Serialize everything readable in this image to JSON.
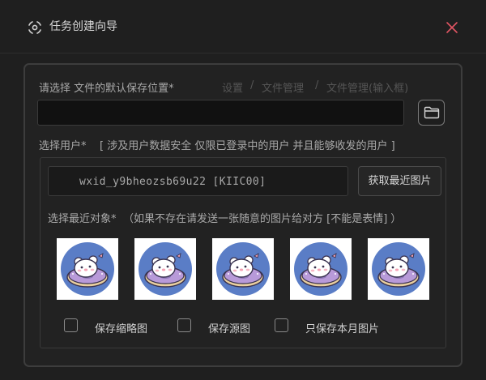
{
  "window": {
    "title": "任务创建向导",
    "icon": "wizard-icon",
    "close_icon": "close-icon",
    "close_color": "#e05563"
  },
  "save_location": {
    "label": "请选择 文件的默认保存位置*",
    "breadcrumb": [
      "设置",
      "文件管理",
      "文件管理(输入框)"
    ],
    "path_value": "",
    "browse_icon": "folder-icon"
  },
  "user_select": {
    "label": "选择用户*",
    "note": "[ 涉及用户数据安全  仅限已登录中的用户 并且能够收发的用户 ]",
    "wxid": "wxid_y9bheozsb69u22 [KIIC00]",
    "fetch_button": "获取最近图片",
    "recent_label": "选择最近对象*",
    "recent_hint": "（如果不存在请发送一张随意的图片给对方 [不能是表情] ）",
    "images": [
      {
        "name": "bear-donut-1"
      },
      {
        "name": "bear-donut-2"
      },
      {
        "name": "bear-donut-3"
      },
      {
        "name": "bear-donut-4"
      },
      {
        "name": "bear-donut-5"
      }
    ]
  },
  "options": [
    {
      "label": "保存缩略图",
      "checked": false
    },
    {
      "label": "保存源图",
      "checked": false
    },
    {
      "label": "只保存本月图片",
      "checked": false
    }
  ]
}
